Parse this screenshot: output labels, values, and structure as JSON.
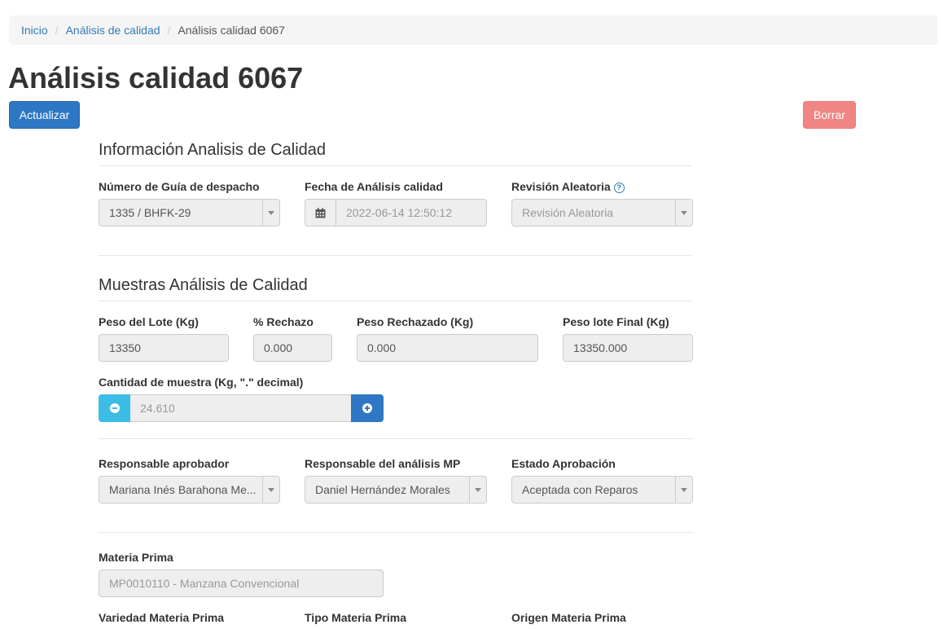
{
  "breadcrumb": {
    "items": [
      "Inicio",
      "Análisis de calidad"
    ],
    "current": "Análisis calidad 6067"
  },
  "page_title": "Análisis calidad 6067",
  "buttons": {
    "update": "Actualizar",
    "delete": "Borrar"
  },
  "section_info": {
    "title": "Información Analisis de Calidad",
    "guia_label": "Número de Guía de despacho",
    "guia_value": "1335 / BHFK-29",
    "fecha_label": "Fecha de Análisis calidad",
    "fecha_value": "2022-06-14 12:50:12",
    "revision_label": "Revisión Aleatoria",
    "revision_value": "Revisión Aleatoria"
  },
  "section_muestras": {
    "title": "Muestras Análisis de Calidad",
    "peso_lote_label": "Peso del Lote (Kg)",
    "peso_lote_value": "13350",
    "rechazo_label": "% Rechazo",
    "rechazo_value": "0.000",
    "peso_rechazado_label": "Peso Rechazado (Kg)",
    "peso_rechazado_value": "0.000",
    "peso_final_label": "Peso lote Final (Kg)",
    "peso_final_value": "13350.000",
    "cantidad_label": "Cantidad de muestra (Kg, \".\" decimal)",
    "cantidad_value": "24.610"
  },
  "section_responsables": {
    "aprobador_label": "Responsable aprobador",
    "aprobador_value": "Mariana Inés Barahona Me...",
    "analisis_label": "Responsable del análisis MP",
    "analisis_value": "Daniel Hernández Morales",
    "estado_label": "Estado Aprobación",
    "estado_value": "Aceptada con Reparos"
  },
  "section_materia": {
    "materia_label": "Materia Prima",
    "materia_value": "MP0010110 - Manzana Convencional",
    "variedad_label": "Variedad Materia Prima",
    "tipo_label": "Tipo Materia Prima",
    "origen_label": "Origen Materia Prima"
  },
  "colors": {
    "primary": "#2e77c4",
    "info": "#3bbde6",
    "danger": "#f08684",
    "link": "#337ab7"
  },
  "icons": {
    "calendar": "calendar-icon",
    "help": "question-circle-icon",
    "minus": "minus-circle-icon",
    "plus": "plus-circle-icon"
  }
}
